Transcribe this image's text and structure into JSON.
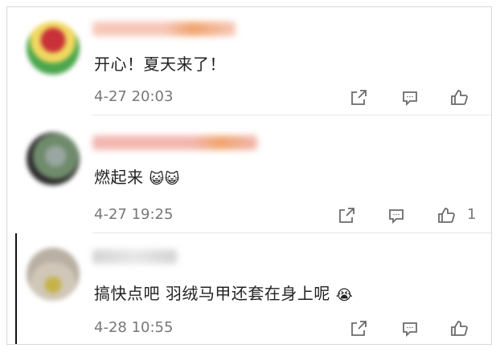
{
  "comments": [
    {
      "avatar_colors": [
        "#c93138",
        "#f0d860",
        "#4aa64c"
      ],
      "name_colors": [
        "#f7c7b9",
        "#f0a56e"
      ],
      "text": "开心！夏天来了！",
      "emoji": "",
      "time": "4-27 20:03",
      "icons": [
        "share-icon",
        "comment-icon",
        "like-icon"
      ],
      "like_count": ""
    },
    {
      "avatar_colors": [
        "#6f8b6b",
        "#9aa6a0",
        "#2a2a2a"
      ],
      "name_colors": [
        "#f2b7b0",
        "#f0a56e"
      ],
      "text": "燃起来",
      "emoji": "😺😺",
      "time": "4-27 19:25",
      "icons": [
        "share-icon",
        "comment-icon",
        "like-icon"
      ],
      "like_count": "1"
    },
    {
      "avatar_colors": [
        "#b9b0a3",
        "#d0c7b8",
        "#c5b34a"
      ],
      "name_colors": [
        "#d4d4d4",
        "#e8e8e8"
      ],
      "text": "搞快点吧 羽绒马甲还套在身上呢",
      "emoji": "😭",
      "time": "4-28 10:55",
      "icons": [
        "share-icon",
        "comment-icon",
        "like-icon"
      ],
      "like_count": ""
    }
  ]
}
